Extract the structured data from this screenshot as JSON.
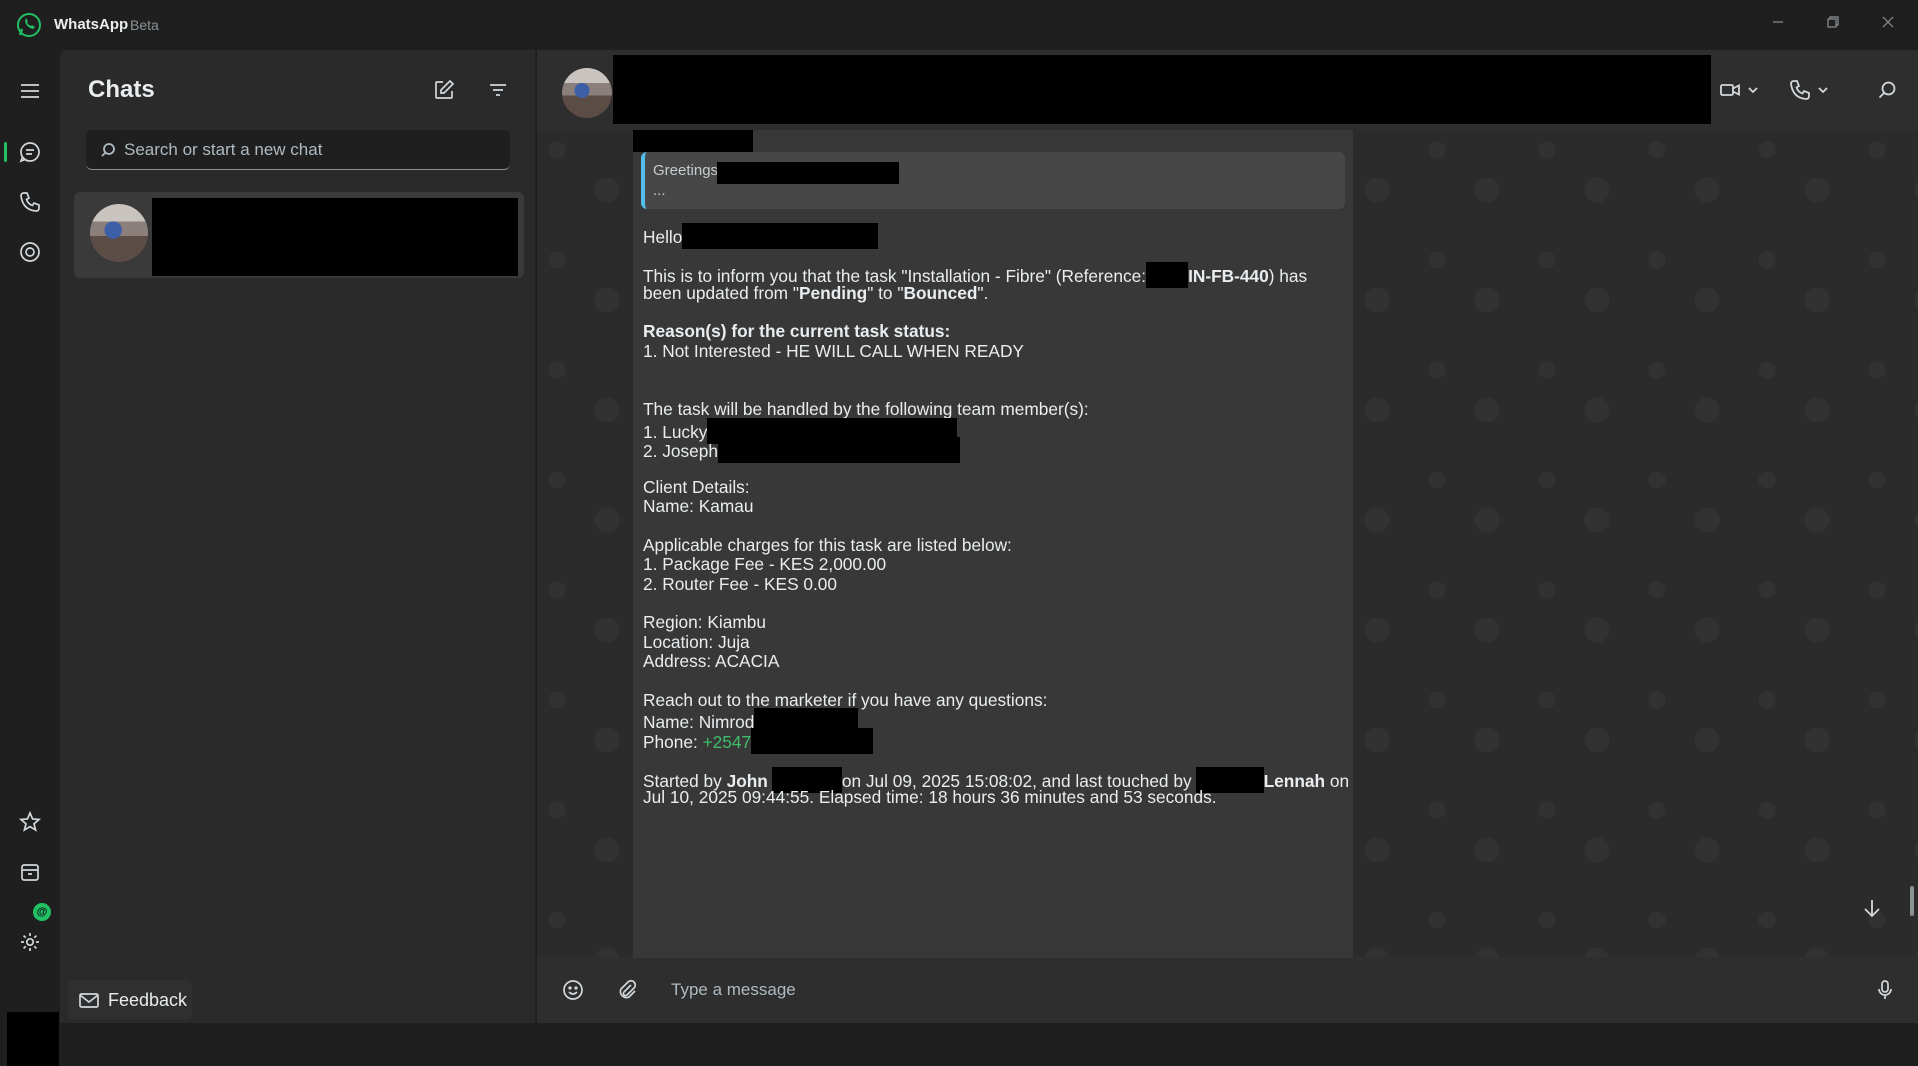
{
  "window": {
    "app_name": "WhatsApp",
    "app_suffix": "Beta",
    "minimize_icon": "minimize-icon",
    "maximize_icon": "restore-icon",
    "close_icon": "close-icon"
  },
  "rail": {
    "items": [
      "menu-icon",
      "chats-icon",
      "calls-icon",
      "status-icon",
      "starred-icon",
      "archived-icon",
      "settings-icon"
    ],
    "active": "chats",
    "archive_badge": "@"
  },
  "chat_list": {
    "title": "Chats",
    "search_placeholder": "Search or start a new chat",
    "feedback_label": "Feedback"
  },
  "composer": {
    "placeholder": "Type a message"
  },
  "message": {
    "quote_title": "Greetings",
    "quote_sub": "...",
    "hello": "Hello",
    "inform_1a": "This is to inform you that the task \"Installation - Fibre\" (Reference:",
    "inform_1b": "IN-FB-440",
    "inform_1c": ") has",
    "inform_2a": "been updated from \"",
    "status_from": "Pending",
    "inform_2b": "\" to \"",
    "status_to": "Bounced",
    "inform_2c": "\".",
    "reasons_heading": "Reason(s) for the current task status:",
    "reason_1": "1. Not Interested - HE WILL CALL WHEN READY",
    "team_heading": "The task will be handled by the following team member(s):",
    "team_1": "1. Lucky",
    "team_2": "2. Joseph",
    "client_heading": "Client Details:",
    "client_name": "Name: Kamau",
    "charges_heading": "Applicable charges for this task are listed below:",
    "charge_1": "1. Package Fee - KES 2,000.00",
    "charge_2": "2. Router Fee - KES 0.00",
    "region": "Region: Kiambu",
    "location": "Location: Juja",
    "address": "Address: ACACIA",
    "marketer_heading": "Reach out to the marketer if you have any questions:",
    "marketer_name": "Name: Nimrod",
    "marketer_phone_label": "Phone: ",
    "marketer_phone": "+2547",
    "started_by_prefix": "Started by ",
    "started_by_name": "John",
    "started_on": "on Jul 09, 2025 15:08:02, and last touched by",
    "touched_by_name": "Lennah",
    "on_word": " on",
    "line_last": "Jul 10, 2025 09:44:55. Elapsed time: 18 hours 36 minutes and 53 seconds."
  }
}
